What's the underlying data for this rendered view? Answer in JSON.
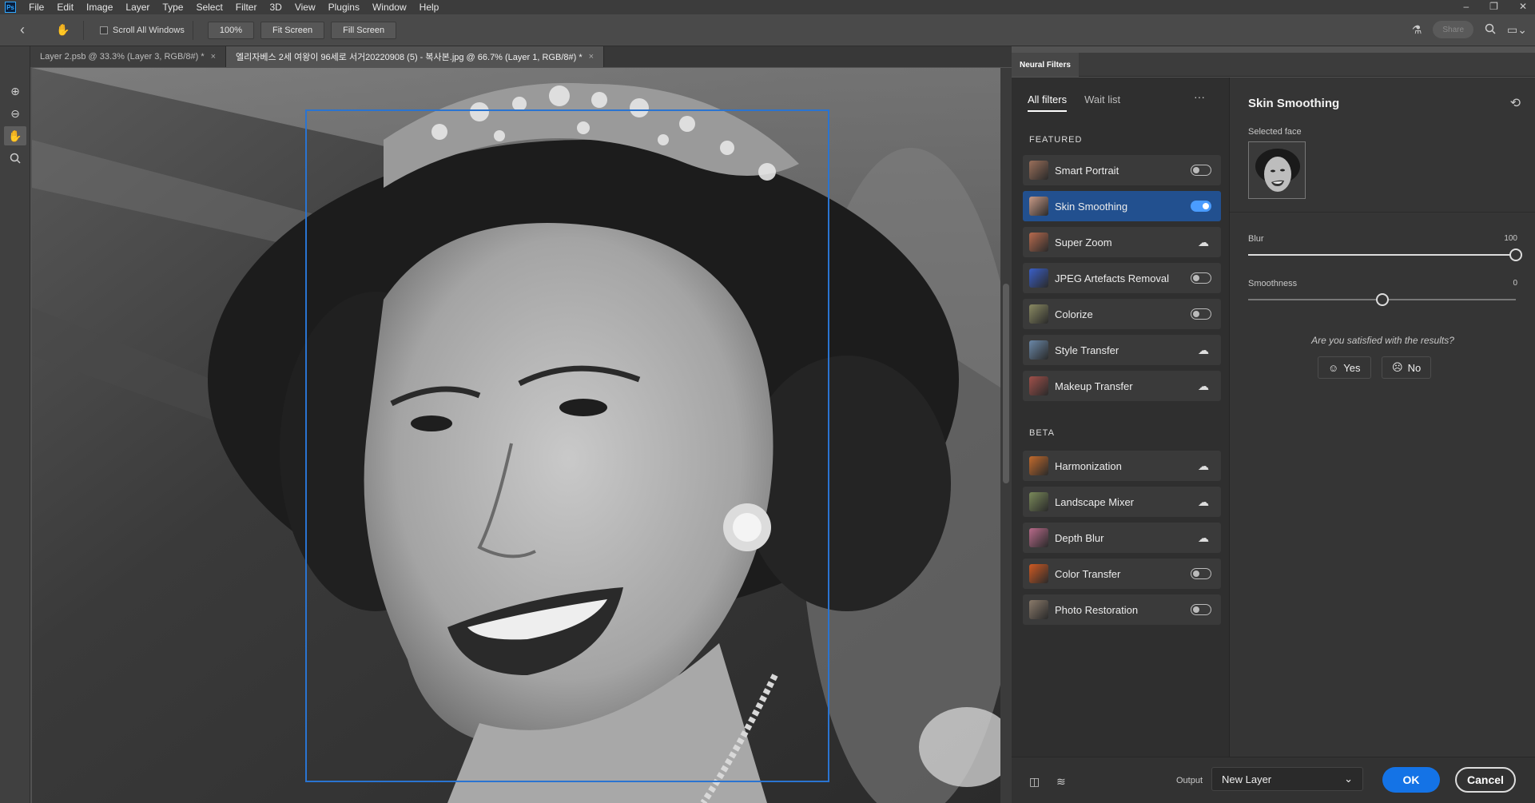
{
  "menubar": {
    "logo": "Ps",
    "items": [
      "File",
      "Edit",
      "Image",
      "Layer",
      "Type",
      "Select",
      "Filter",
      "3D",
      "View",
      "Plugins",
      "Window",
      "Help"
    ],
    "window_controls": [
      "–",
      "❐",
      "✕"
    ]
  },
  "options": {
    "scroll_all": "Scroll All Windows",
    "zoom_100": "100%",
    "fit_screen": "Fit Screen",
    "fill_screen": "Fill Screen",
    "share": "Share"
  },
  "tabs": [
    {
      "label": "Layer 2.psb @ 33.3% (Layer 3, RGB/8#) *"
    },
    {
      "label": "엘리자베스 2세 여왕이 96세로 서거20220908 (5) - 복사본.jpg @ 66.7% (Layer 1, RGB/8#) *"
    }
  ],
  "neural": {
    "panel_tab": "Neural Filters",
    "tab_all": "All filters",
    "tab_wait": "Wait list",
    "featured_heading": "FEATURED",
    "beta_heading": "BETA",
    "featured": [
      {
        "label": "Smart Portrait",
        "state": "off",
        "thumb": "#9a6f5a"
      },
      {
        "label": "Skin Smoothing",
        "state": "on",
        "thumb": "#c89a86"
      },
      {
        "label": "Super Zoom",
        "state": "cloud",
        "thumb": "#b76a4e"
      },
      {
        "label": "JPEG Artefacts Removal",
        "state": "off",
        "thumb": "#3a5fc8"
      },
      {
        "label": "Colorize",
        "state": "off",
        "thumb": "#8a8a62"
      },
      {
        "label": "Style Transfer",
        "state": "cloud",
        "thumb": "#6a88a8"
      },
      {
        "label": "Makeup Transfer",
        "state": "cloud",
        "thumb": "#a0504a"
      }
    ],
    "beta": [
      {
        "label": "Harmonization",
        "state": "cloud",
        "thumb": "#c26a2c"
      },
      {
        "label": "Landscape Mixer",
        "state": "cloud",
        "thumb": "#7a8a5a"
      },
      {
        "label": "Depth Blur",
        "state": "cloud",
        "thumb": "#b86a8a"
      },
      {
        "label": "Color Transfer",
        "state": "off",
        "thumb": "#d05a22"
      },
      {
        "label": "Photo Restoration",
        "state": "off",
        "thumb": "#8a7a6a"
      }
    ]
  },
  "skin": {
    "title": "Skin Smoothing",
    "selected_face": "Selected face",
    "blur_label": "Blur",
    "blur_value": "100",
    "blur_fraction": 1.0,
    "smooth_label": "Smoothness",
    "smooth_value": "0",
    "smooth_fraction": 0.5,
    "question": "Are you satisfied with the results?",
    "yes": "Yes",
    "no": "No"
  },
  "bottom": {
    "output_label": "Output",
    "output_value": "New Layer",
    "ok": "OK",
    "cancel": "Cancel"
  },
  "colors": {
    "accent": "#1473e6",
    "selected_row": "#22508f",
    "face_box": "#2a74d1"
  }
}
